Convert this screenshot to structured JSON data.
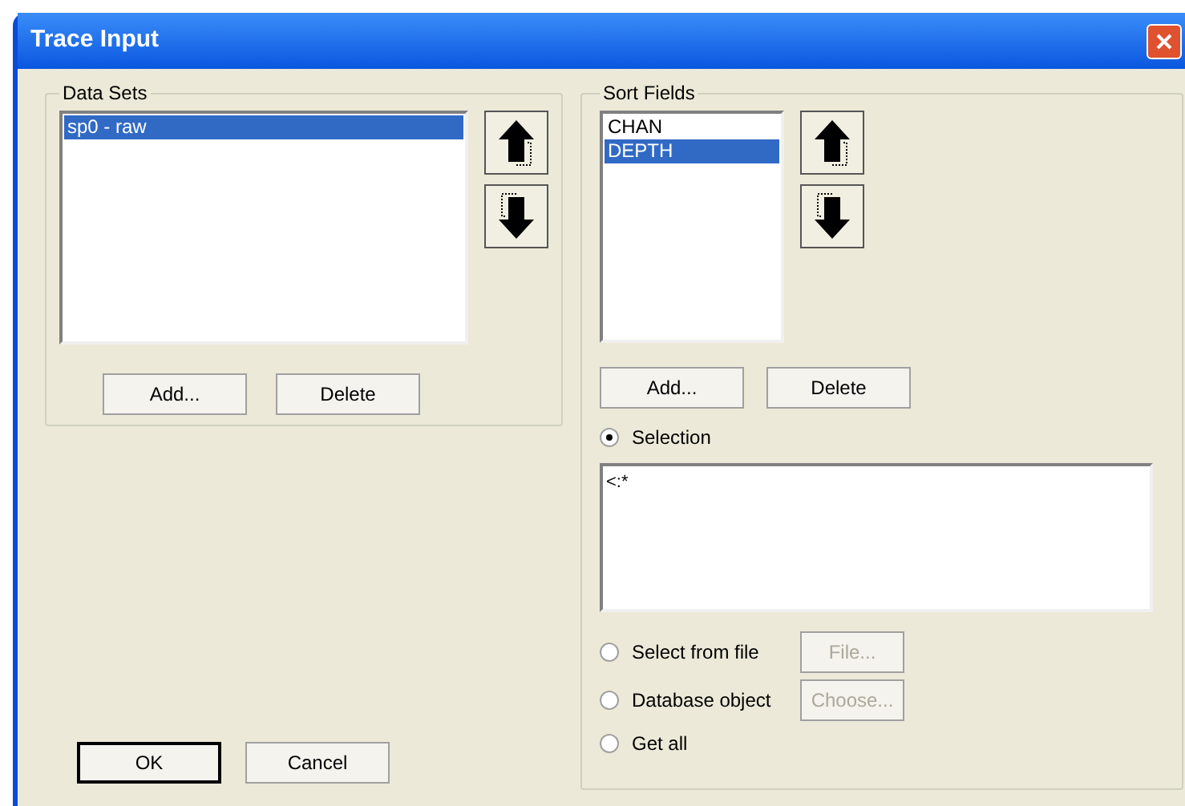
{
  "window": {
    "title": "Trace Input"
  },
  "data_sets": {
    "title": "Data Sets",
    "items": [
      {
        "label": "sp0 - raw",
        "selected": true
      }
    ],
    "buttons": [
      {
        "label": "Add..."
      },
      {
        "label": "Delete"
      }
    ]
  },
  "sort_fields": {
    "title": "Sort Fields",
    "items": [
      {
        "label": "CHAN",
        "selected": false
      },
      {
        "label": "DEPTH",
        "selected": true
      }
    ],
    "buttons": [
      {
        "label": "Add..."
      },
      {
        "label": "Delete"
      }
    ],
    "options": [
      {
        "label": "Selection",
        "selected": true
      },
      {
        "label": "Select from file",
        "selected": false,
        "button": {
          "label": "File...",
          "disabled": true
        }
      },
      {
        "label": "Database object",
        "selected": false,
        "button": {
          "label": "Choose...",
          "disabled": true
        }
      },
      {
        "label": "Get all",
        "selected": false
      }
    ],
    "selection": {
      "value": "<:*"
    }
  },
  "buttons": [
    {
      "label": "OK",
      "default": true
    },
    {
      "label": "Cancel",
      "default": false
    }
  ]
}
